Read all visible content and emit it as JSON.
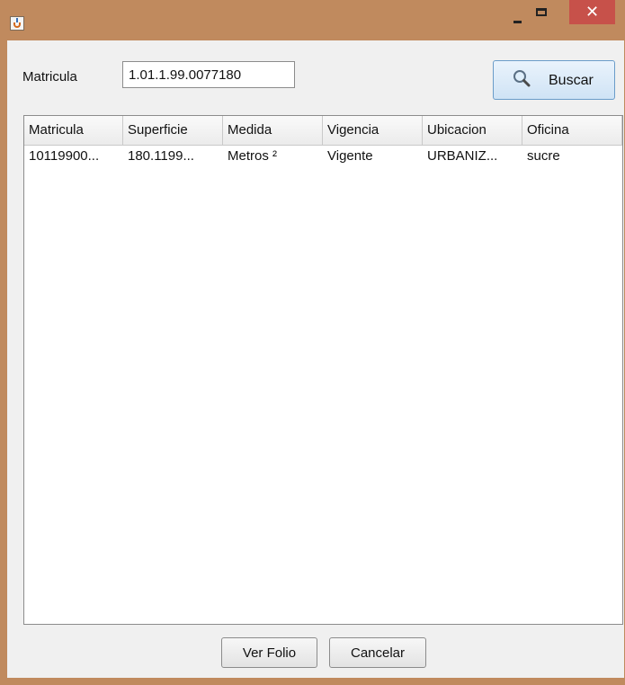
{
  "window": {
    "title": "",
    "controls": {
      "minimize": "_",
      "maximize": "□",
      "close": "✕"
    }
  },
  "search": {
    "label": "Matricula",
    "value": "1.01.1.99.0077180",
    "button_label": "Buscar",
    "button_icon": "search-icon"
  },
  "table": {
    "columns": [
      "Matricula",
      "Superficie",
      "Medida",
      "Vigencia",
      "Ubicacion",
      "Oficina"
    ],
    "rows": [
      [
        "10119900...",
        "180.1199...",
        "Metros ²",
        "Vigente",
        "URBANIZ...",
        "sucre"
      ]
    ]
  },
  "footer": {
    "ver_folio_label": "Ver Folio",
    "cancelar_label": "Cancelar"
  }
}
